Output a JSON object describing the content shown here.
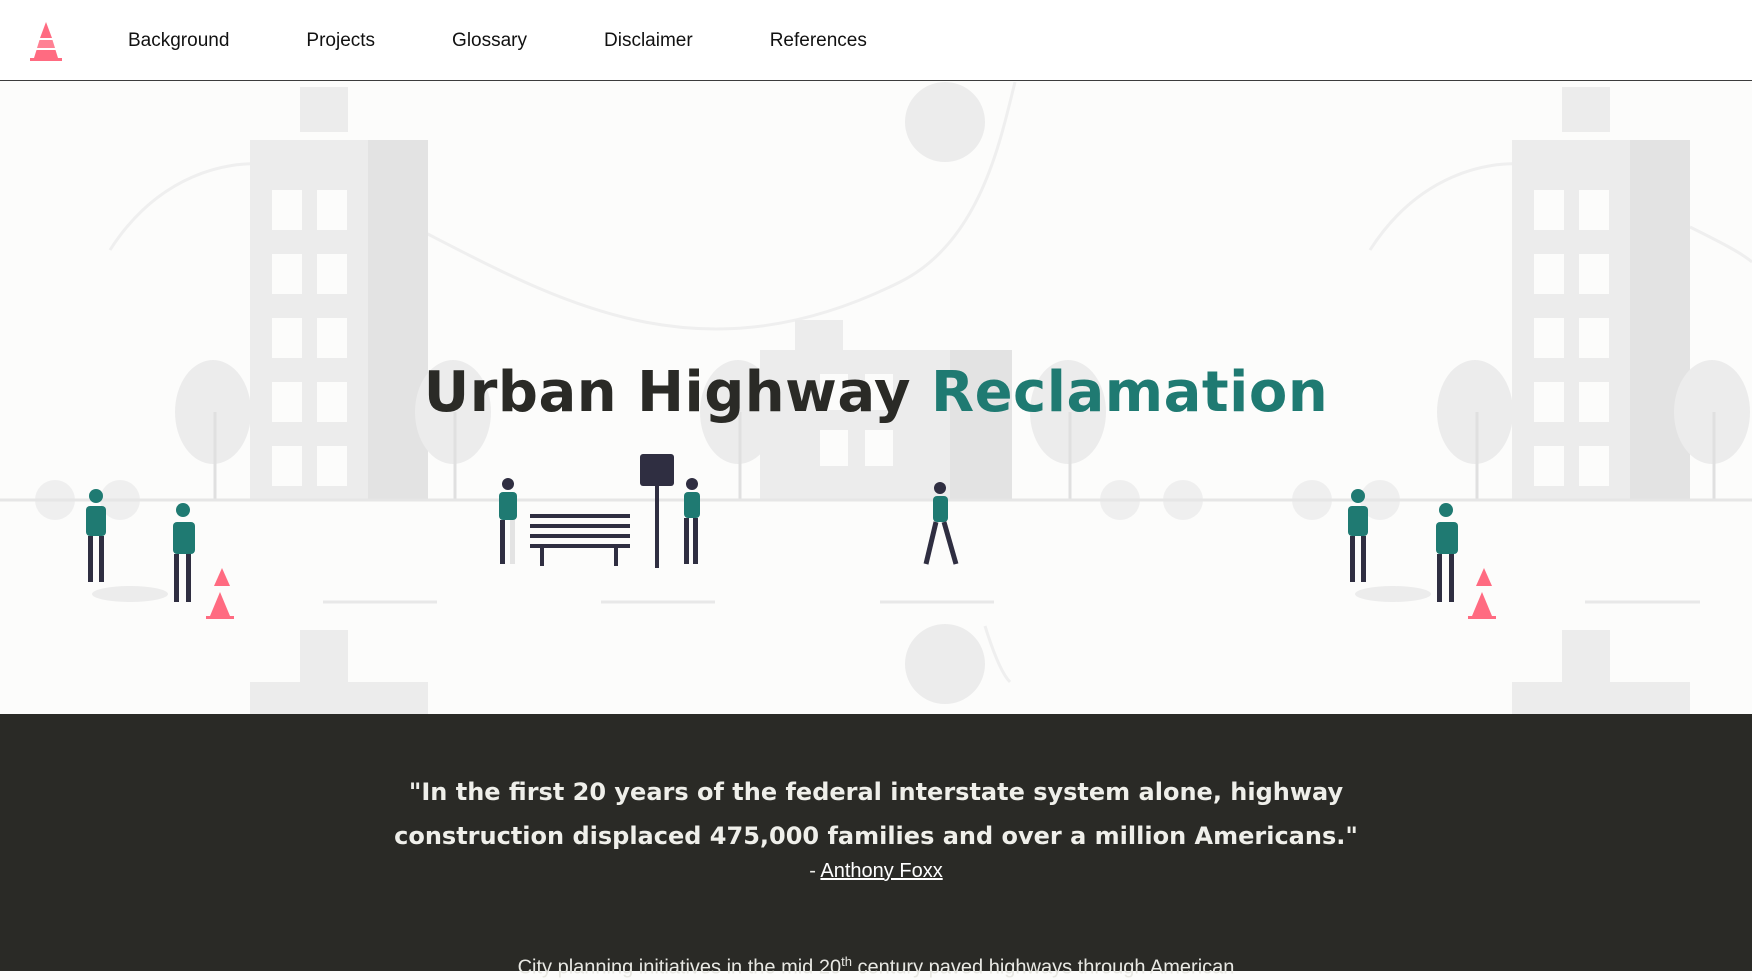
{
  "nav": {
    "logo_icon": "traffic-cone-icon",
    "items": [
      {
        "label": "Background"
      },
      {
        "label": "Projects"
      },
      {
        "label": "Glossary"
      },
      {
        "label": "Disclaimer"
      },
      {
        "label": "References"
      }
    ]
  },
  "hero": {
    "title_part1": "Urban Highway",
    "title_part2": "Reclamation",
    "illustration": "city-street-illustration"
  },
  "quote": {
    "text": "\"In the first 20 years of the federal interstate system alone, highway construction displaced 475,000 families and over a million Americans.\"",
    "attribution_prefix": "- ",
    "author": "Anthony Foxx"
  },
  "intro": {
    "text_before": "City planning initiatives in the mid 20",
    "superscript": "th",
    "text_after": " century paved highways through American"
  },
  "colors": {
    "accent": "#1f7a72",
    "cone": "#ff6b81",
    "dark_band": "#2a2a26",
    "figure_dark": "#2f2e41"
  }
}
